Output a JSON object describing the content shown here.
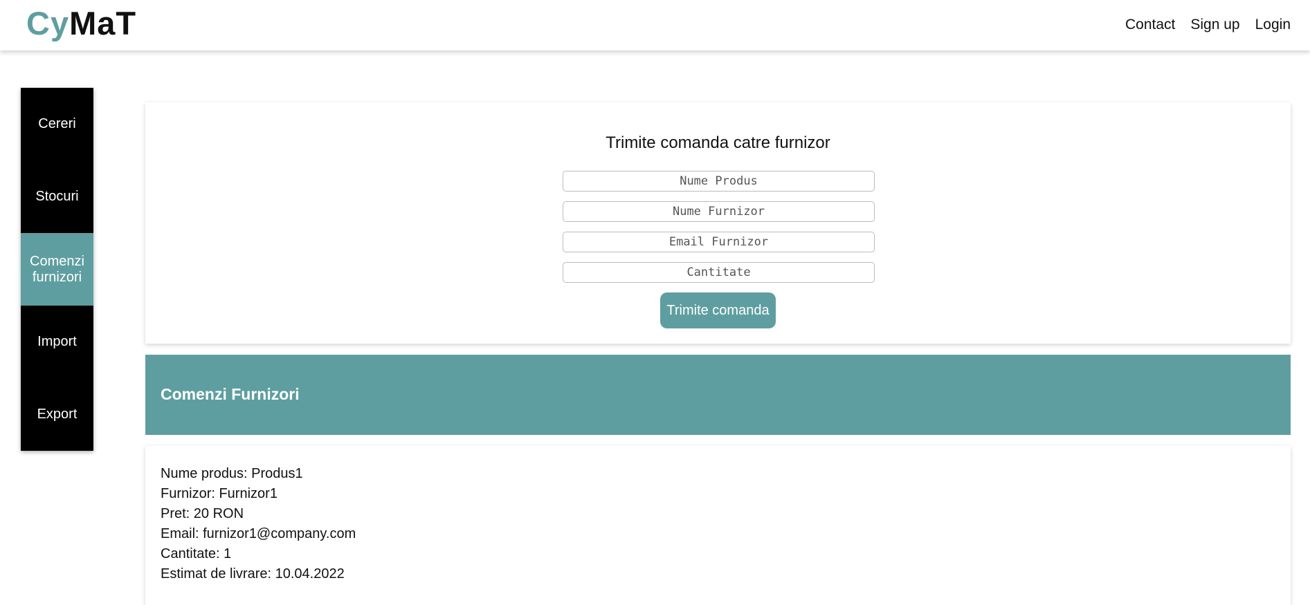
{
  "brand": {
    "logo_part1": "Cy",
    "logo_part2": "MaT",
    "accent_color": "#5f9ea0"
  },
  "nav": {
    "contact": "Contact",
    "signup": "Sign up",
    "login": "Login"
  },
  "sidebar": {
    "items": [
      {
        "label": "Cereri"
      },
      {
        "label": "Stocuri"
      },
      {
        "label": "Comenzi furnizori",
        "active": true
      },
      {
        "label": "Import"
      },
      {
        "label": "Export"
      }
    ]
  },
  "form": {
    "title": "Trimite comanda catre furnizor",
    "product_placeholder": "Nume Produs",
    "supplier_placeholder": "Nume Furnizor",
    "email_placeholder": "Email Furnizor",
    "quantity_placeholder": "Cantitate",
    "submit_label": "Trimite comanda"
  },
  "orders_section": {
    "title": "Comenzi Furnizori"
  },
  "orders": [
    {
      "product": "Nume produs: Produs1",
      "supplier": "Furnizor: Furnizor1",
      "price": "Pret: 20 RON",
      "email": "Email: furnizor1@company.com",
      "quantity": "Cantitate: 1",
      "delivery": "Estimat de livrare: 10.04.2022"
    }
  ]
}
